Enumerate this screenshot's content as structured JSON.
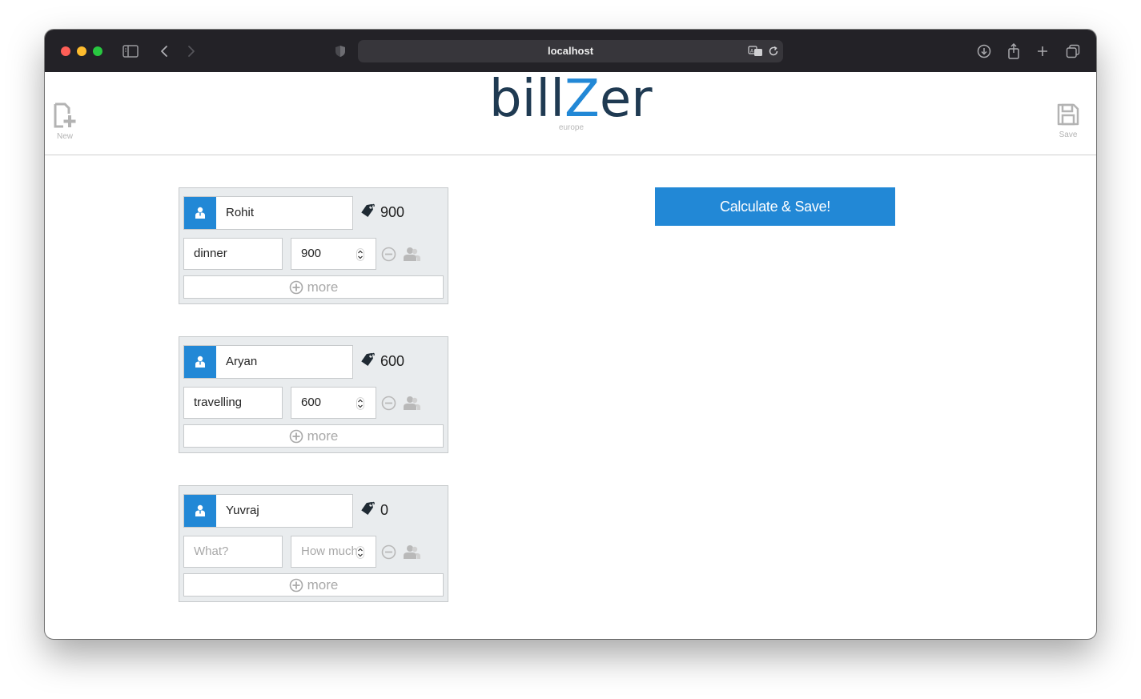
{
  "browser": {
    "url": "localhost"
  },
  "header": {
    "new_label": "New",
    "save_label": "Save",
    "logo_prefix": "bill",
    "logo_accent": "Z",
    "logo_suffix": "er",
    "logo_sub": "europe"
  },
  "people": [
    {
      "name": "Rohit",
      "total": "900",
      "expense_what": "dinner",
      "expense_what_placeholder": "What?",
      "expense_amount": "900",
      "expense_amount_placeholder": "How much?",
      "more_label": "more"
    },
    {
      "name": "Aryan",
      "total": "600",
      "expense_what": "travelling",
      "expense_what_placeholder": "What?",
      "expense_amount": "600",
      "expense_amount_placeholder": "How much?",
      "more_label": "more"
    },
    {
      "name": "Yuvraj",
      "total": "0",
      "expense_what": "",
      "expense_what_placeholder": "What?",
      "expense_amount": "",
      "expense_amount_placeholder": "How much?",
      "more_label": "more"
    }
  ],
  "actions": {
    "calculate_label": "Calculate & Save!"
  },
  "colors": {
    "accent": "#2288d6",
    "logo_dark": "#1f3a52",
    "card_bg": "#e9ecee",
    "titlebar": "#232227"
  },
  "icons": {
    "person": "person-icon",
    "total": "price-tag-icon",
    "remove": "minus-circle-icon",
    "split": "users-icon",
    "add": "plus-circle-icon",
    "new": "new-document-icon",
    "save": "floppy-disk-icon"
  }
}
